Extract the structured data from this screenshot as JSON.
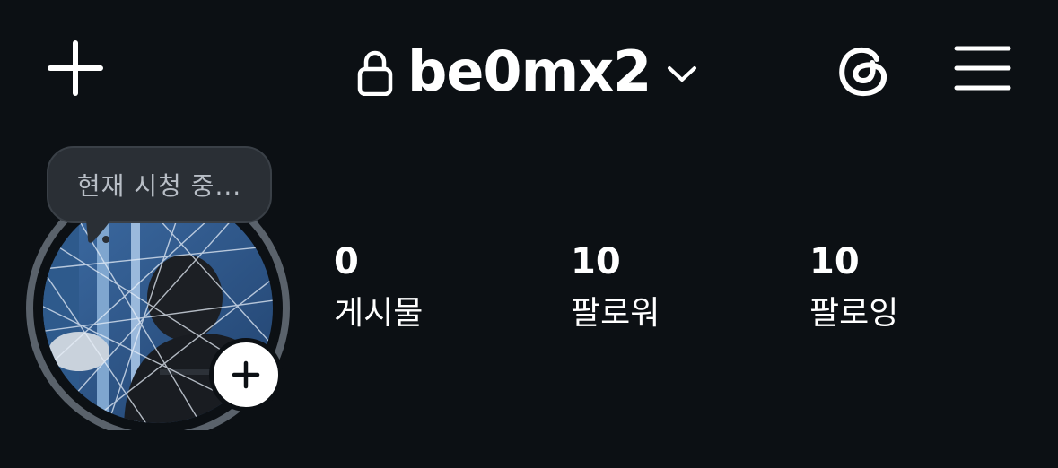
{
  "header": {
    "username": "be0mx2",
    "icons": {
      "add": "plus-icon",
      "lock": "lock-icon",
      "dropdown": "chevron-down-icon",
      "threads": "threads-icon",
      "menu": "hamburger-menu-icon"
    }
  },
  "profile": {
    "note_tooltip": "현재 시청 중...",
    "add_story_icon": "plus-icon",
    "stats": [
      {
        "value": "0",
        "label": "게시물"
      },
      {
        "value": "10",
        "label": "팔로워"
      },
      {
        "value": "10",
        "label": "팔로잉"
      }
    ]
  },
  "colors": {
    "background": "#0c1014",
    "text": "#ffffff",
    "tooltip_bg": "#2a2f35",
    "ring": "#5a626b"
  }
}
